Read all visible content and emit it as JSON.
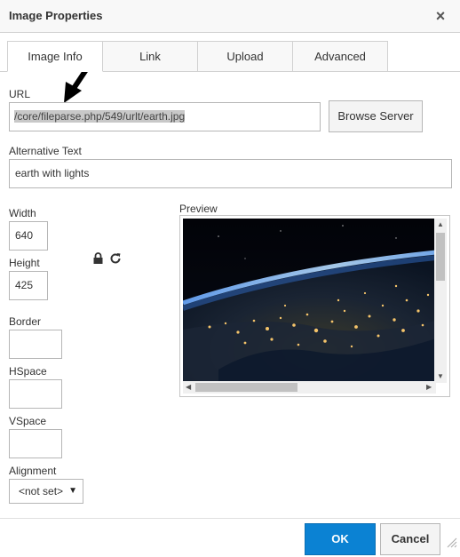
{
  "dialog": {
    "title": "Image Properties",
    "close_glyph": "×"
  },
  "tabs": [
    {
      "label": "Image Info",
      "active": true
    },
    {
      "label": "Link",
      "active": false
    },
    {
      "label": "Upload",
      "active": false
    },
    {
      "label": "Advanced",
      "active": false
    }
  ],
  "url": {
    "label": "URL",
    "value": "/core/fileparse.php/549/urlt/earth.jpg",
    "browse_label": "Browse Server"
  },
  "alt": {
    "label": "Alternative Text",
    "value": "earth with lights"
  },
  "dimensions": {
    "width_label": "Width",
    "width_value": "640",
    "height_label": "Height",
    "height_value": "425",
    "lock_icon": "lock-icon",
    "reset_icon": "reset-size-icon"
  },
  "border": {
    "label": "Border",
    "value": ""
  },
  "hspace": {
    "label": "HSpace",
    "value": ""
  },
  "vspace": {
    "label": "VSpace",
    "value": ""
  },
  "alignment": {
    "label": "Alignment",
    "selected": "<not set>"
  },
  "preview": {
    "label": "Preview",
    "image_desc_icon": "earth-at-night-image"
  },
  "footer": {
    "ok_label": "OK",
    "cancel_label": "Cancel"
  },
  "colors": {
    "ok_button": "#0b82d3",
    "selection_highlight": "#c8c8c8"
  }
}
